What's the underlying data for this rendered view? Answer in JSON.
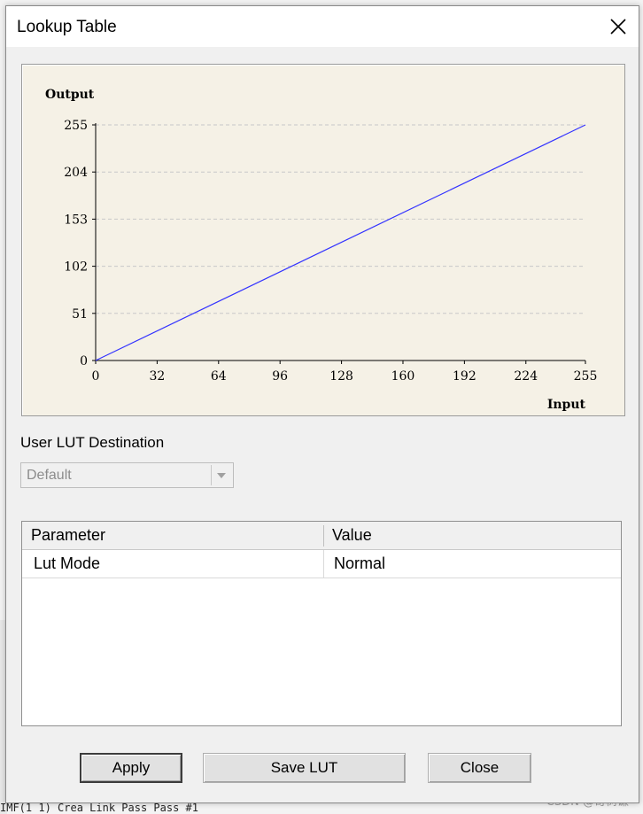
{
  "dialog": {
    "title": "Lookup Table"
  },
  "chart_data": {
    "type": "line",
    "xlabel": "Input",
    "ylabel": "Output",
    "xticks": [
      0,
      32,
      64,
      96,
      128,
      160,
      192,
      224,
      255
    ],
    "yticks": [
      0,
      51,
      102,
      153,
      204,
      255
    ],
    "xlim": [
      0,
      255
    ],
    "ylim": [
      0,
      255
    ],
    "grid": "horizontal-dashed",
    "series": [
      {
        "x": [
          0,
          255
        ],
        "y": [
          0,
          255
        ],
        "color": "#3333ff"
      }
    ]
  },
  "destination": {
    "label": "User LUT Destination",
    "selected": "Default"
  },
  "grid": {
    "headers": [
      "Parameter",
      "Value"
    ],
    "rows": [
      {
        "parameter": "Lut Mode",
        "value": "Normal"
      }
    ]
  },
  "buttons": {
    "apply": "Apply",
    "save": "Save LUT",
    "close": "Close"
  },
  "background": {
    "console_text": "IMF(1 1)      Crea Link Pass Pass #1",
    "watermark": "CSDN @奇树谦"
  },
  "colors": {
    "chart_bg": "#f5f1e6",
    "line": "#3333ff",
    "grid": "#c8c8c8"
  }
}
